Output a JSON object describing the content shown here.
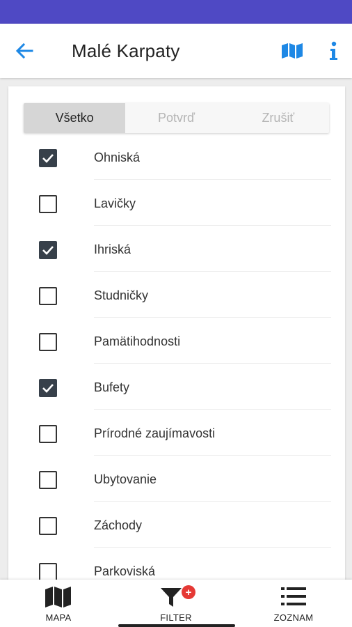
{
  "header": {
    "title": "Malé Karpaty",
    "back_icon": "arrow-left-icon",
    "map_icon": "map-icon",
    "info_icon": "info-icon",
    "accent_color": "#1e88e5",
    "status_bar_color": "#4f49c4"
  },
  "segmented": {
    "all": "Všetko",
    "confirm": "Potvrď",
    "cancel": "Zrušiť",
    "active": "all"
  },
  "filters": [
    {
      "label": "Ohniská",
      "checked": true
    },
    {
      "label": "Lavičky",
      "checked": false
    },
    {
      "label": "Ihriská",
      "checked": true
    },
    {
      "label": "Studničky",
      "checked": false
    },
    {
      "label": "Pamätihodnosti",
      "checked": false
    },
    {
      "label": "Bufety",
      "checked": true
    },
    {
      "label": "Prírodné zaujímavosti",
      "checked": false
    },
    {
      "label": "Ubytovanie",
      "checked": false
    },
    {
      "label": "Záchody",
      "checked": false
    },
    {
      "label": "Parkoviská",
      "checked": false
    }
  ],
  "bottom_nav": {
    "map": {
      "label": "MAPA",
      "icon": "map-icon"
    },
    "filter": {
      "label": "FILTER",
      "icon": "filter-icon",
      "badge": "+"
    },
    "list": {
      "label": "ZOZNAM",
      "icon": "list-icon"
    }
  }
}
